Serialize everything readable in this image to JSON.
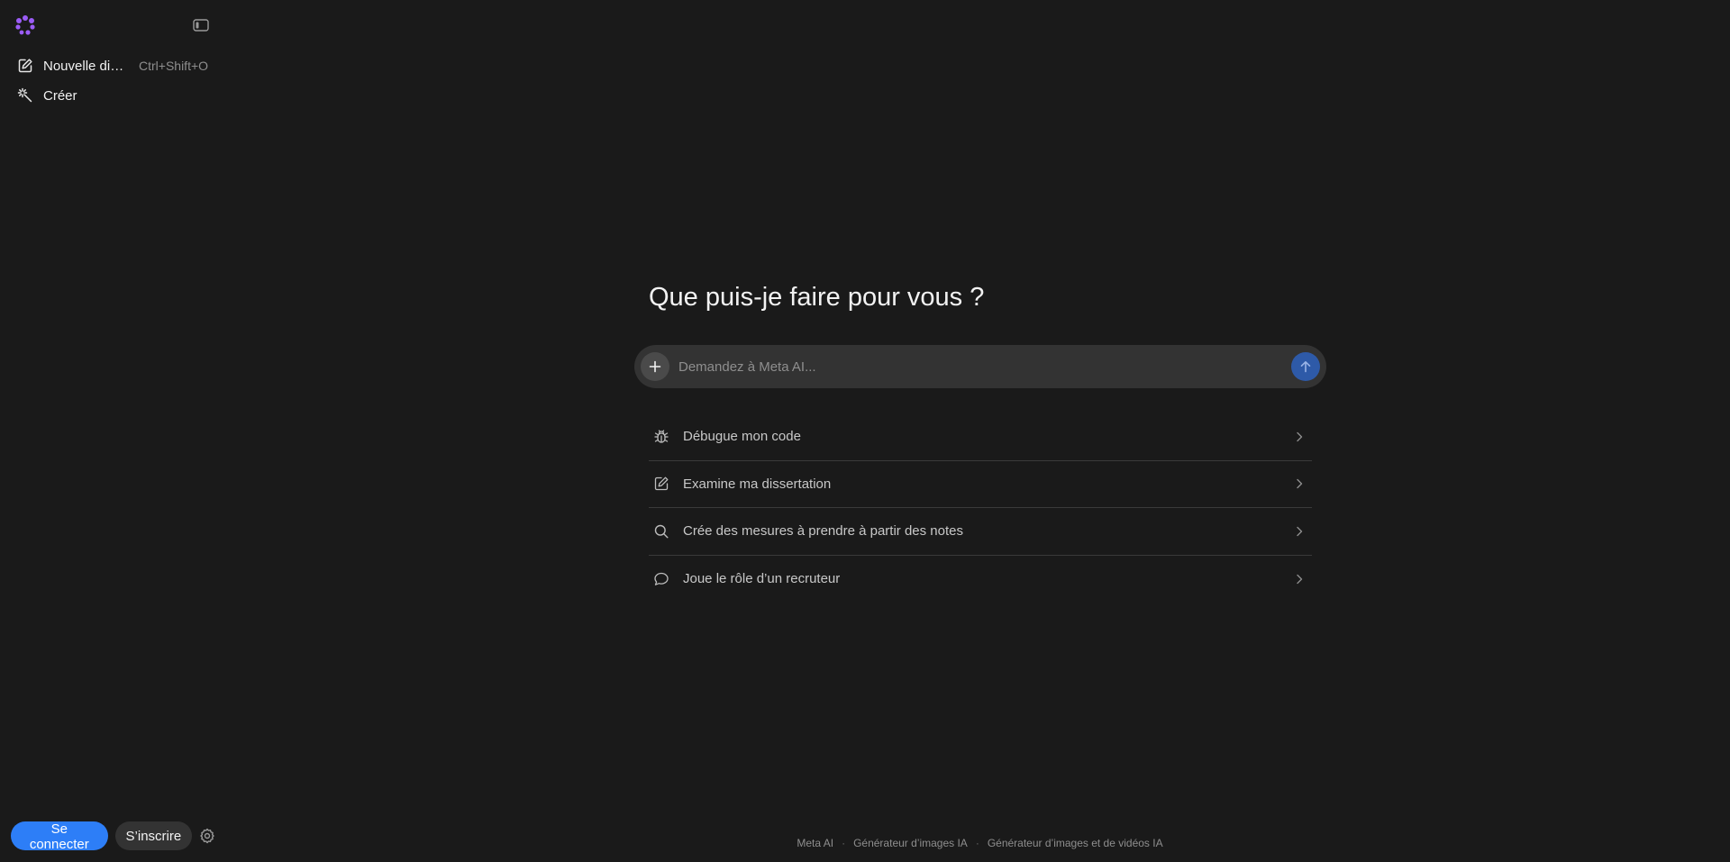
{
  "sidebar": {
    "new_chat": {
      "label": "Nouvelle discussion",
      "shortcut": "Ctrl+Shift+O"
    },
    "create": {
      "label": "Créer"
    }
  },
  "auth": {
    "login_label": "Se connecter",
    "signup_label": "S’inscrire"
  },
  "main": {
    "headline": "Que puis-je faire pour vous ?",
    "composer": {
      "placeholder": "Demandez à Meta AI..."
    },
    "suggestions": [
      {
        "icon": "bug-icon",
        "label": "Débugue mon code"
      },
      {
        "icon": "edit-icon",
        "label": "Examine ma dissertation"
      },
      {
        "icon": "search-icon",
        "label": "Crée des mesures à prendre à partir des notes"
      },
      {
        "icon": "chat-bubble-icon",
        "label": "Joue le rôle d’un recruteur"
      }
    ]
  },
  "footer": {
    "links": [
      "Meta AI",
      "Générateur d’images IA",
      "Générateur d’images et de vidéos IA"
    ]
  },
  "colors": {
    "background": "#1a1a1a",
    "accent": "#2d7ef7",
    "send": "#2e5aa8",
    "logo": "#9b5cf6"
  }
}
